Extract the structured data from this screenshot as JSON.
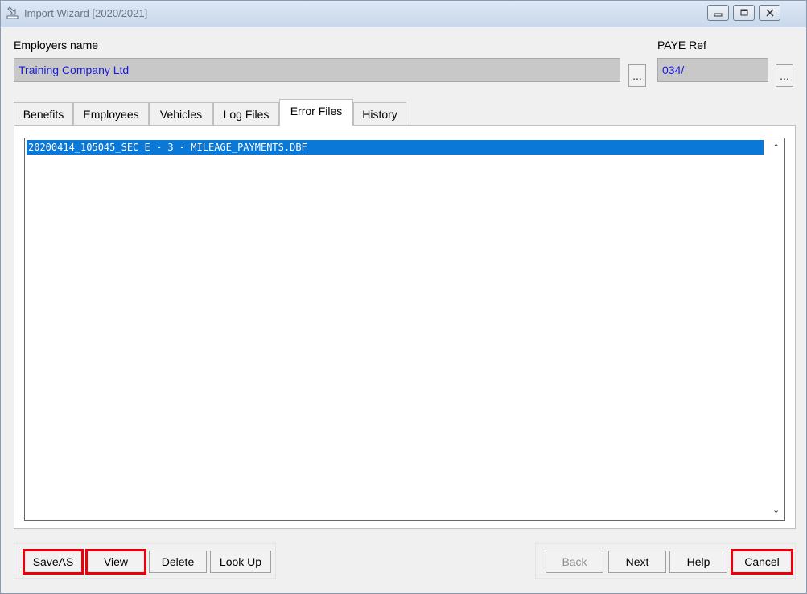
{
  "window": {
    "title": "Import Wizard [2020/2021]",
    "icons": [
      "app-icon",
      "minimize-icon",
      "restore-icon",
      "close-icon"
    ]
  },
  "employer": {
    "label": "Employers name",
    "value": "Training Company Ltd",
    "browse_label": "..."
  },
  "paye": {
    "label": "PAYE Ref",
    "value": "034/",
    "browse_label": "..."
  },
  "tabs": [
    {
      "label": "Benefits",
      "active": false
    },
    {
      "label": "Employees",
      "active": false
    },
    {
      "label": "Vehicles",
      "active": false
    },
    {
      "label": "Log Files",
      "active": false
    },
    {
      "label": "Error Files",
      "active": true
    },
    {
      "label": "History",
      "active": false
    }
  ],
  "error_files": {
    "items": [
      "20200414_105045_SEC E - 3 - MILEAGE_PAYMENTS.DBF"
    ],
    "selected_index": 0
  },
  "left_buttons": [
    {
      "label": "SaveAS",
      "highlighted": true
    },
    {
      "label": "View",
      "highlighted": true
    },
    {
      "label": "Delete",
      "highlighted": false
    },
    {
      "label": "Look Up",
      "highlighted": false
    }
  ],
  "right_buttons": [
    {
      "label": "Back",
      "enabled": false,
      "highlighted": false
    },
    {
      "label": "Next",
      "enabled": true,
      "highlighted": false
    },
    {
      "label": "Help",
      "enabled": true,
      "highlighted": false
    },
    {
      "label": "Cancel",
      "enabled": true,
      "highlighted": true
    }
  ],
  "colors": {
    "selection": "#0a78d7",
    "field_text": "#1a1ad6",
    "highlight_outline": "#e8000b"
  }
}
